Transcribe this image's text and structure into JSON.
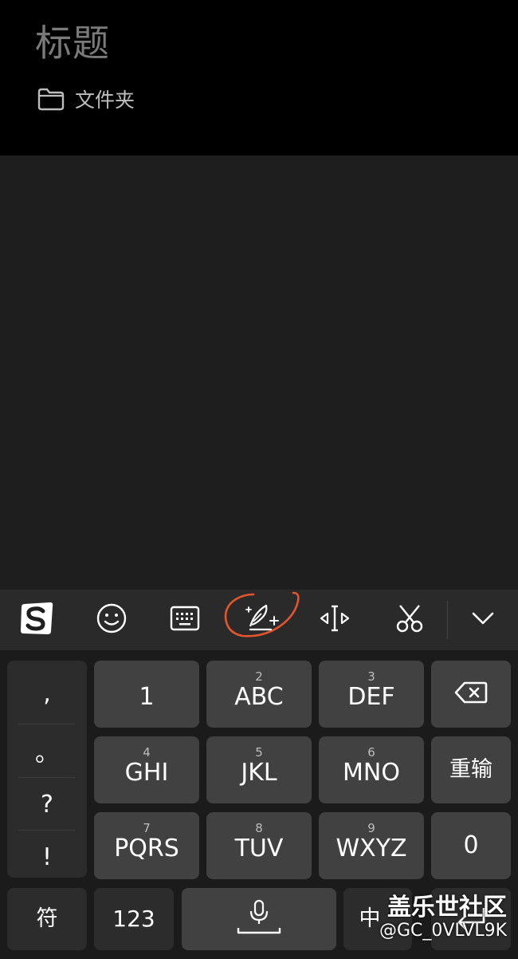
{
  "note": {
    "title_placeholder": "标题",
    "folder_label": "文件夹"
  },
  "toolbar": {
    "items": [
      "sogou-logo-icon",
      "emoji-icon",
      "keyboard-icon",
      "handwriting-quill-icon",
      "cursor-move-icon",
      "scissors-icon",
      "collapse-chevron-icon"
    ],
    "highlight_color": "#e2552d"
  },
  "keyboard": {
    "punctuation": [
      ",",
      "。",
      "?",
      "!"
    ],
    "keys": [
      {
        "sub": "",
        "main": "1"
      },
      {
        "sub": "2",
        "main": "ABC"
      },
      {
        "sub": "3",
        "main": "DEF"
      },
      {
        "sub": "4",
        "main": "GHI"
      },
      {
        "sub": "5",
        "main": "JKL"
      },
      {
        "sub": "6",
        "main": "MNO"
      },
      {
        "sub": "7",
        "main": "PQRS"
      },
      {
        "sub": "8",
        "main": "TUV"
      },
      {
        "sub": "9",
        "main": "WXYZ"
      }
    ],
    "reenter_label": "重输",
    "zero_label": "0",
    "symbols_label": "符",
    "numbers_label": "123",
    "lang_label": "中"
  },
  "watermark": {
    "title": "盖乐世社区",
    "id": "@GC_0VLVL9K"
  }
}
